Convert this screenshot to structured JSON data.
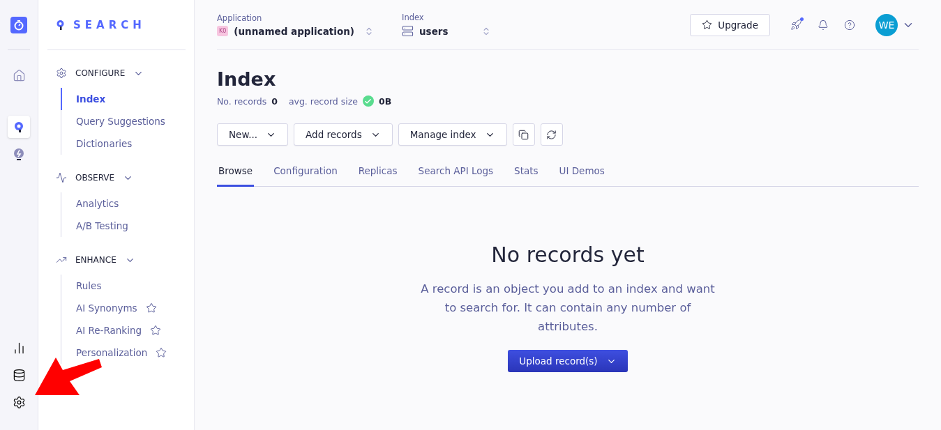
{
  "rail": {
    "items": [
      {
        "kind": "home",
        "selected": false
      },
      {
        "kind": "search",
        "selected": true
      },
      {
        "kind": "bulb",
        "selected": false
      }
    ],
    "bottom_items": [
      {
        "kind": "chart"
      },
      {
        "kind": "database"
      },
      {
        "kind": "settings"
      }
    ]
  },
  "sidebar": {
    "logo": "SEARCH",
    "sections": [
      {
        "title": "CONFIGURE",
        "kind": "gear",
        "expanded": true,
        "items": [
          {
            "label": "Index",
            "selected": true,
            "starred": false
          },
          {
            "label": "Query Suggestions",
            "selected": false,
            "starred": false
          },
          {
            "label": "Dictionaries",
            "selected": false,
            "starred": false
          }
        ]
      },
      {
        "title": "OBSERVE",
        "kind": "pulse",
        "expanded": true,
        "items": [
          {
            "label": "Analytics",
            "selected": false,
            "starred": false
          },
          {
            "label": "A/B Testing",
            "selected": false,
            "starred": false
          }
        ]
      },
      {
        "title": "ENHANCE",
        "kind": "trend",
        "expanded": true,
        "items": [
          {
            "label": "Rules",
            "selected": false,
            "starred": false
          },
          {
            "label": "AI Synonyms",
            "selected": false,
            "starred": true
          },
          {
            "label": "AI Re-Ranking",
            "selected": false,
            "starred": true
          },
          {
            "label": "Personalization",
            "selected": false,
            "starred": true
          }
        ]
      }
    ]
  },
  "topbar": {
    "application": {
      "label": "Application",
      "badge": "K0",
      "value": "(unnamed application)"
    },
    "index": {
      "label": "Index",
      "value": "users"
    },
    "upgrade": "Upgrade",
    "notification_dot": true,
    "avatar": "WE"
  },
  "page": {
    "title": "Index",
    "stats": [
      {
        "label": "No. records",
        "value": "0",
        "ok": false
      },
      {
        "label": "avg. record size",
        "value": "0B",
        "ok": true
      }
    ],
    "buttons": [
      "New...",
      "Add records",
      "Manage index"
    ],
    "tabs": [
      {
        "label": "Browse",
        "selected": true
      },
      {
        "label": "Configuration",
        "selected": false
      },
      {
        "label": "Replicas",
        "selected": false
      },
      {
        "label": "Search API Logs",
        "selected": false
      },
      {
        "label": "Stats",
        "selected": false
      },
      {
        "label": "UI Demos",
        "selected": false
      }
    ],
    "empty": {
      "title": "No records yet",
      "text": "A record is an object you add to an index and want to search for. It can contain any number of attributes.",
      "button": "Upload record(s)"
    }
  },
  "annotation": {
    "kind": "arrow"
  }
}
